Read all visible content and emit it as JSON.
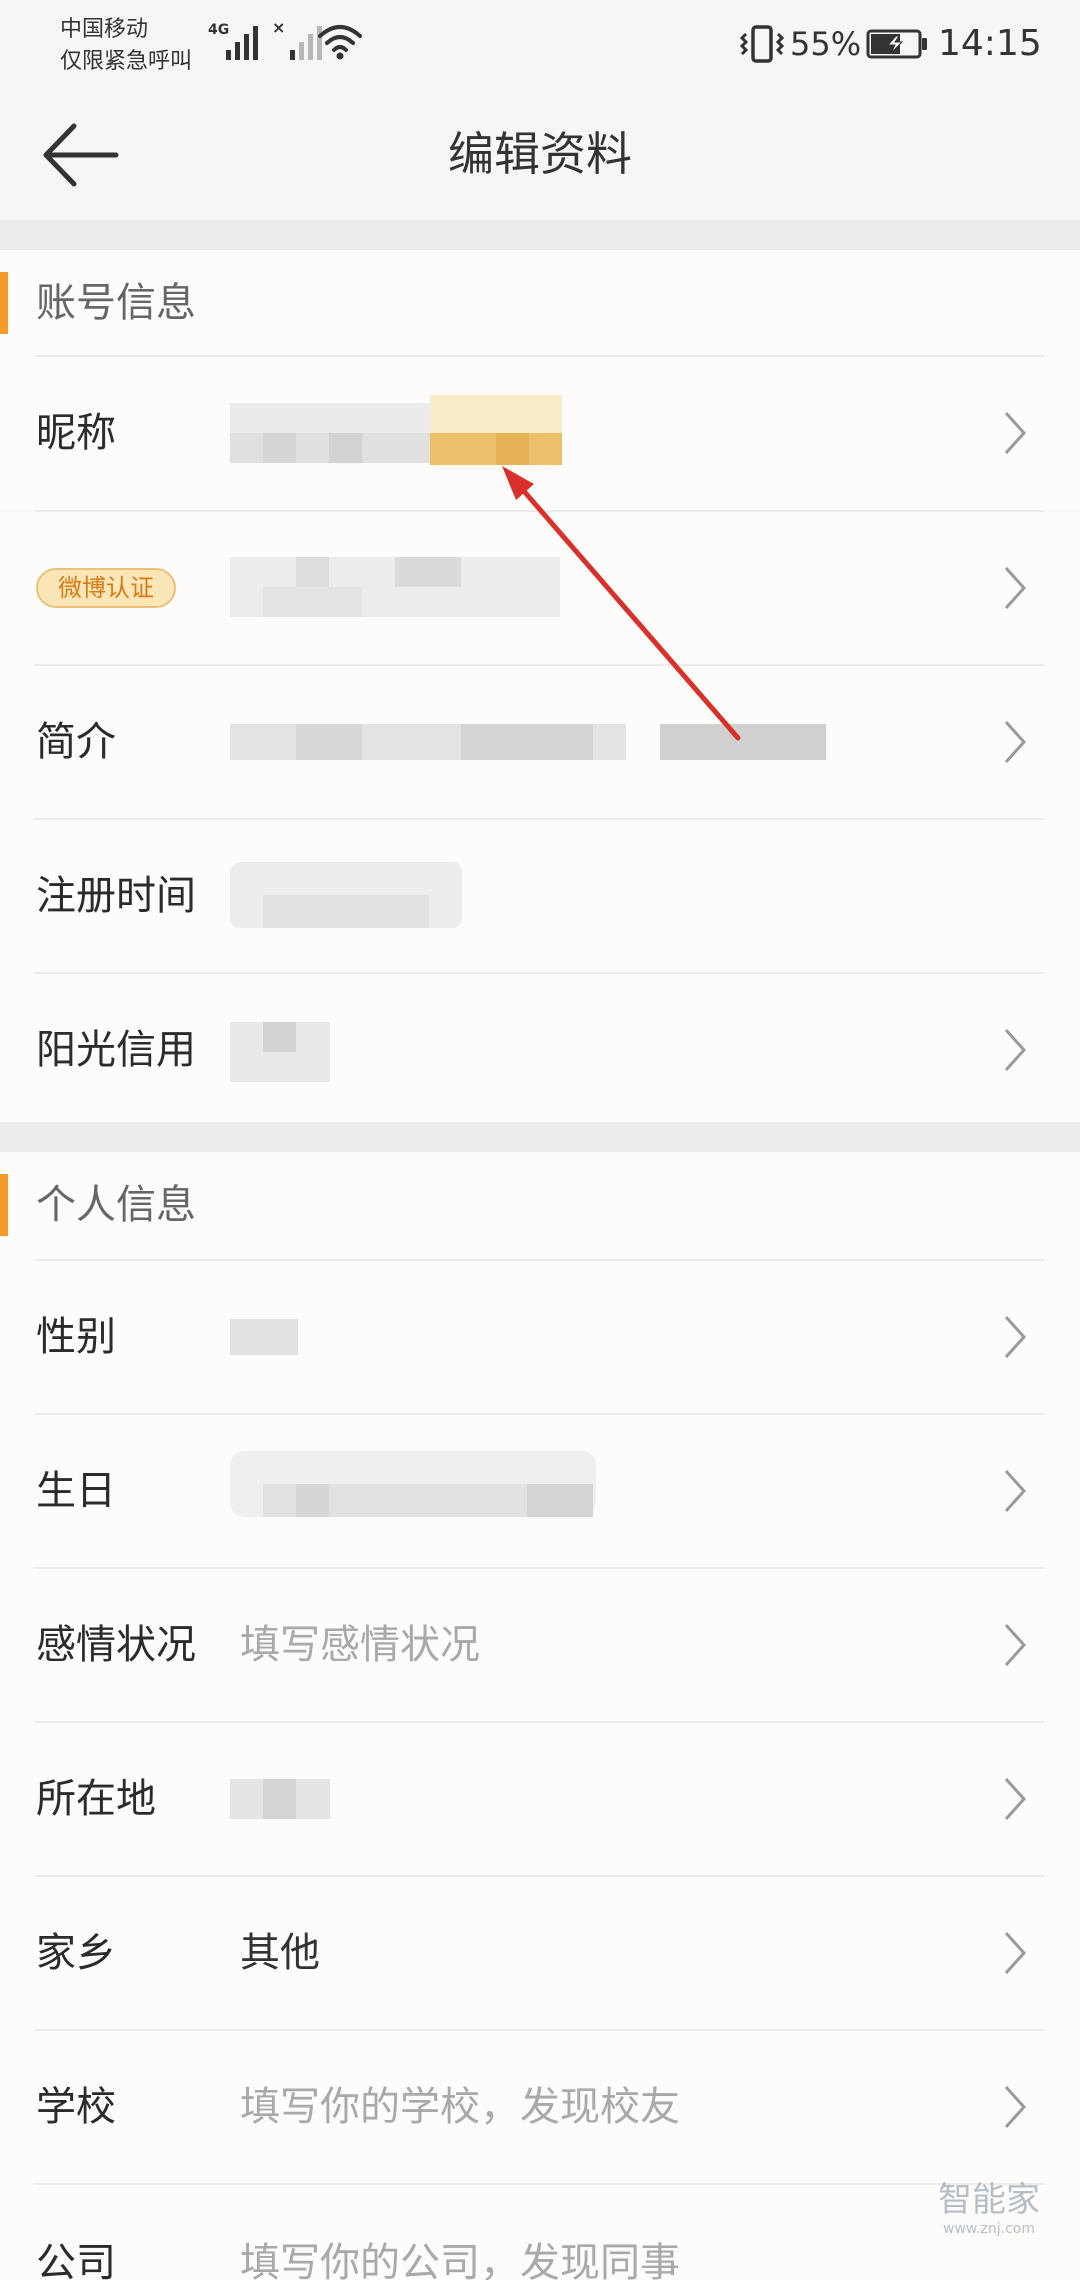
{
  "status_bar": {
    "carrier_line1": "中国移动",
    "carrier_line2": "仅限紧急呼叫",
    "network_type": "4G",
    "battery_percent": "55%",
    "time": "14:15",
    "icons": [
      "signal-icon",
      "no-sim-signal-icon",
      "wifi-icon",
      "vibrate-icon",
      "battery-charging-icon"
    ]
  },
  "nav": {
    "title": "编辑资料",
    "back_icon": "back-arrow-icon"
  },
  "account_section": {
    "title": "账号信息",
    "rows": [
      {
        "label": "昵称",
        "value": "",
        "blurred": true,
        "chevron": true
      },
      {
        "label": "微博认证",
        "value": "",
        "blurred": true,
        "chevron": true
      },
      {
        "label": "简介",
        "value": "",
        "blurred": true,
        "chevron": true
      },
      {
        "label": "注册时间",
        "value": "",
        "blurred": true,
        "chevron": false
      },
      {
        "label": "阳光信用",
        "value": "",
        "blurred": true,
        "chevron": true
      }
    ]
  },
  "personal_section": {
    "title": "个人信息",
    "rows": [
      {
        "label": "性别",
        "value": "",
        "blurred": true,
        "chevron": true
      },
      {
        "label": "生日",
        "value": "",
        "blurred": true,
        "chevron": true
      },
      {
        "label": "感情状况",
        "value": "填写感情状况",
        "placeholder": true,
        "chevron": true
      },
      {
        "label": "所在地",
        "value": "",
        "blurred": true,
        "chevron": true
      },
      {
        "label": "家乡",
        "value": "其他",
        "placeholder": false,
        "chevron": true
      },
      {
        "label": "学校",
        "value": "填写你的学校，发现校友",
        "placeholder": true,
        "chevron": true
      },
      {
        "label": "公司",
        "value": "填写你的公司，发现同事",
        "placeholder": true,
        "chevron": true
      }
    ]
  },
  "watermark": {
    "text": "智能家",
    "sub": "www.znj.com"
  },
  "colors": {
    "accent": "#f39c2a",
    "annotation_arrow": "#d9302a",
    "badge_text": "#d87a16",
    "placeholder_text": "#a9a9a9",
    "section_gap": "#ececec"
  }
}
